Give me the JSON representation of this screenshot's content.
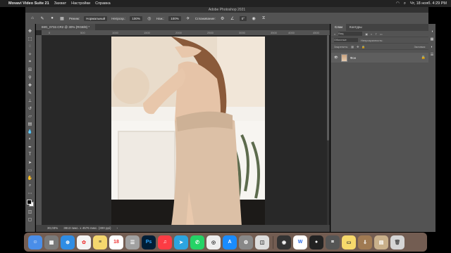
{
  "menubar": {
    "app_name": "Movavi Video Suite 21",
    "items": [
      "Захват",
      "Настройки",
      "Справка"
    ],
    "datetime": "Чт, 18 нояб.  4:29 PM"
  },
  "window": {
    "title": "Adobe Photoshop 2021"
  },
  "options": {
    "mode_label": "Режим:",
    "mode_value": "Нормальный",
    "opacity_label": "Непрозр.:",
    "opacity_value": "100%",
    "flow_label": "Наж.:",
    "flow_value": "100%",
    "smoothing_label": "Сглаживание:",
    "angle_value": "0°"
  },
  "document": {
    "tab_title": "IMG_0732.CR2 @ 30% (RGB/8) *",
    "ruler_ticks": [
      "0",
      "500",
      "1000",
      "1500",
      "2000",
      "2500",
      "3000",
      "3500",
      "4000",
      "4500"
    ],
    "zoom": "30,03%",
    "size_info": "3813 пикс. x 4576 пикс. (300 ppi)"
  },
  "layers_panel": {
    "tabs": [
      "Слои",
      "Контуры"
    ],
    "search_placeholder": "Вид",
    "blend_label": "Обычные",
    "opacity_label": "Непрозрачность:",
    "fill_label": "Заливка:",
    "lock_label": "Закрепить:",
    "layer_name": "Фон"
  },
  "dock": {
    "calendar_day": "18",
    "ps_label": "Ps"
  },
  "colors": {
    "accent": "#4a90e2",
    "ps_blue": "#001e36",
    "canvas_bg": "#282828"
  }
}
